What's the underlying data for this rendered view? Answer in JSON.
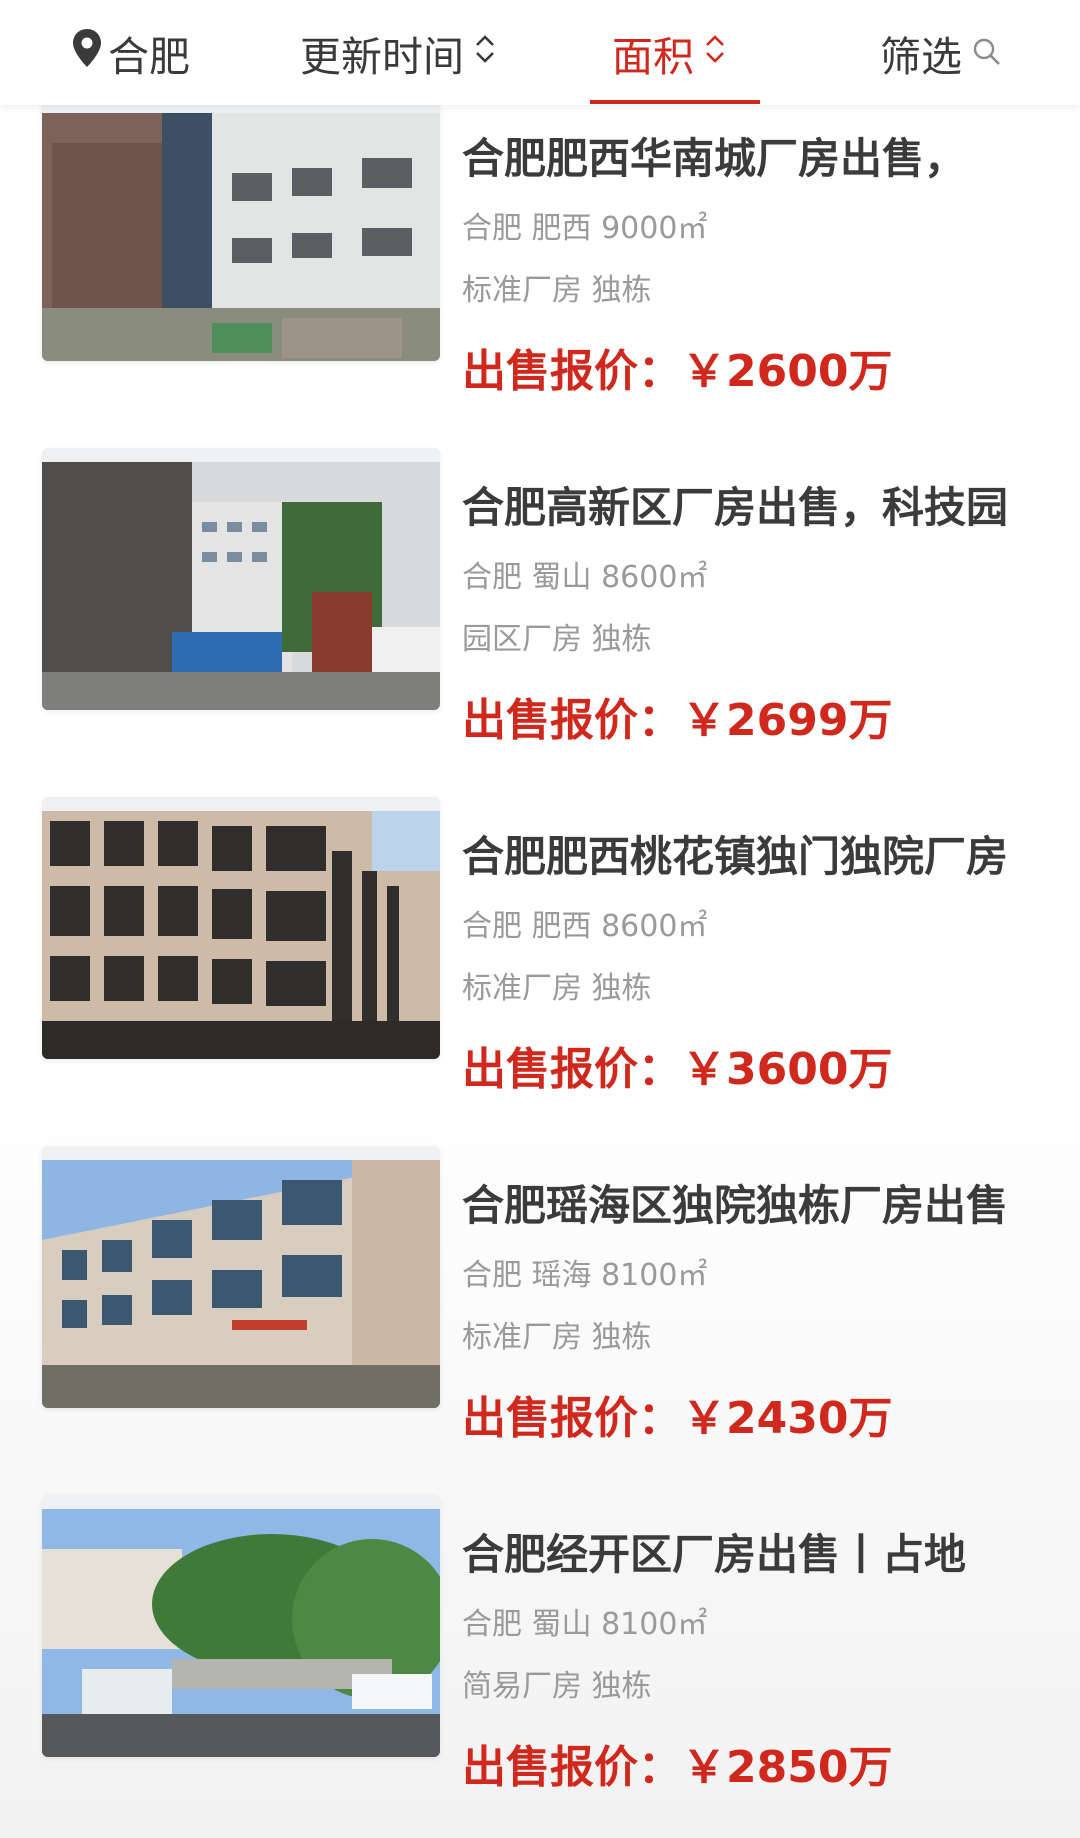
{
  "top_tabs": {
    "city": "合肥",
    "update_time": "更新时间",
    "area": "面积",
    "filter": "筛选"
  },
  "listings": [
    {
      "title": "合肥肥西华南城厂房出售，",
      "location": "合肥 肥西 9000㎡",
      "tags": "标准厂房 独栋",
      "price_label": "出售报价：",
      "price": "￥2600万"
    },
    {
      "title": "合肥高新区厂房出售，科技园",
      "location": "合肥 蜀山 8600㎡",
      "tags": "园区厂房 独栋",
      "price_label": "出售报价：",
      "price": "￥2699万"
    },
    {
      "title": "合肥肥西桃花镇独门独院厂房",
      "location": "合肥 肥西 8600㎡",
      "tags": "标准厂房 独栋",
      "price_label": "出售报价：",
      "price": "￥3600万"
    },
    {
      "title": "合肥瑶海区独院独栋厂房出售",
      "location": "合肥 瑶海 8100㎡",
      "tags": "标准厂房 独栋",
      "price_label": "出售报价：",
      "price": "￥2430万"
    },
    {
      "title": "合肥经开区厂房出售丨占地",
      "location": "合肥 蜀山 8100㎡",
      "tags": "简易厂房 独栋",
      "price_label": "出售报价：",
      "price": "￥2850万"
    }
  ],
  "colors": {
    "accent": "#d0281d",
    "title": "#3b3b3b",
    "meta": "#9a9a9a"
  },
  "icons": [
    "location-pin-icon",
    "sort-chevrons-icon",
    "search-icon"
  ]
}
